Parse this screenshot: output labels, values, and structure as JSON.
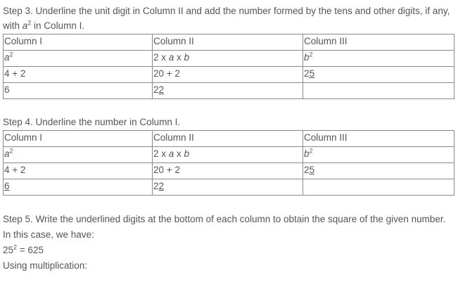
{
  "step3": {
    "text_a": "Step 3. Underline the unit digit in Column II and add the number formed by the tens and other digits, if any, with ",
    "a_var": "a",
    "a_exp": "2",
    "text_b": " in Column I."
  },
  "table1": {
    "headers": [
      "Column I",
      "Column II",
      "Column III"
    ],
    "row1": {
      "c1_var": "a",
      "c1_exp": "2",
      "c2_prefix": "2 x ",
      "c2_a": "a",
      "c2_mid": " x ",
      "c2_b": "b",
      "c3_var": "b",
      "c3_exp": "2"
    },
    "row2": {
      "c1": "4 + 2",
      "c2": "20 + 2",
      "c3_plain": "2",
      "c3_underlined": "5"
    },
    "row3": {
      "c1": "6",
      "c2_plain": "2",
      "c2_underlined": "2",
      "c3": ""
    }
  },
  "step4": {
    "text": "Step 4. Underline the number in Column I."
  },
  "table2": {
    "headers": [
      "Column I",
      "Column II",
      "Column III"
    ],
    "row1": {
      "c1_var": "a",
      "c1_exp": "2",
      "c2_prefix": "2 x ",
      "c2_a": "a",
      "c2_mid": " x ",
      "c2_b": "b",
      "c3_var": "b",
      "c3_exp": "2"
    },
    "row2": {
      "c1": "4 + 2",
      "c2": "20 + 2",
      "c3_plain": "2",
      "c3_underlined": "5"
    },
    "row3": {
      "c1_underlined": "6",
      "c2_plain": "2",
      "c2_underlined": "2",
      "c3": ""
    }
  },
  "step5": {
    "text": "Step 5. Write the underlined digits at the bottom of each column to obtain the square of the given number.",
    "case_text": "In this case, we have:",
    "result_base": "25",
    "result_exp": "2",
    "result_rest": " = 625",
    "using_text": "Using multiplication:"
  }
}
